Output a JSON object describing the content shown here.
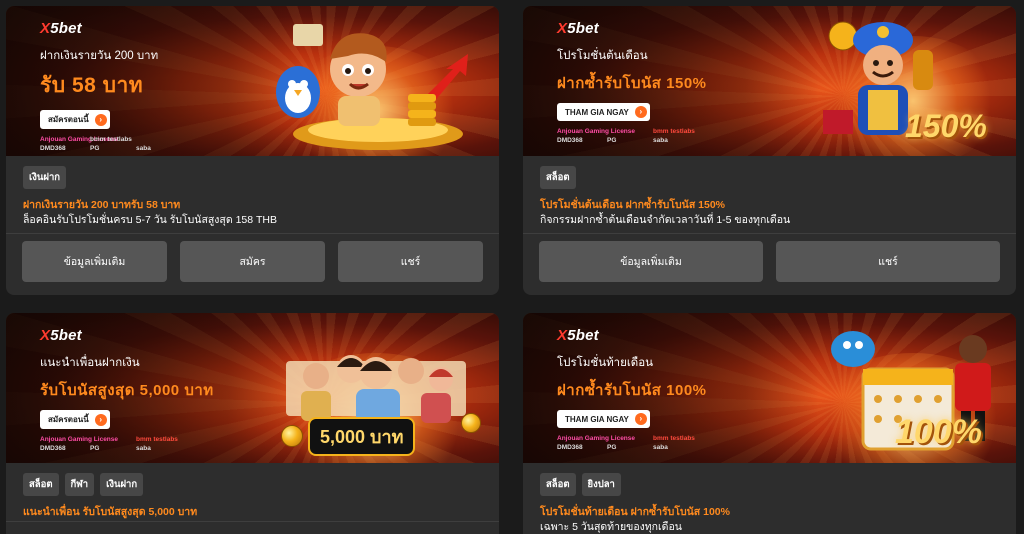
{
  "cards": [
    {
      "logo_x": "X",
      "logo_rest": "5bet",
      "banner_sub": "ฝากเงินรายวัน 200 บาท",
      "banner_head": "รับ 58 บาท",
      "banner_btn": "สมัครตอนนี้",
      "partners": [
        "Anjouan Gaming License",
        "bmm testlabs",
        "DMD368",
        "PG",
        "saba",
        "SA GAMING"
      ],
      "tags": [
        "เงินฝาก"
      ],
      "title": "ฝากเงินรายวัน 200 บาทรับ 58 บาท",
      "body": "ล็อคอินรับโปรโมชั่นครบ 5-7 วัน รับโบนัสสูงสุด 158 THB",
      "buttons": [
        "ข้อมูลเพิ่มเติม",
        "สมัคร",
        "แชร์"
      ]
    },
    {
      "logo_x": "X",
      "logo_rest": "5bet",
      "banner_sub": "โปรโมชั่นต้นเดือน",
      "banner_head": "ฝากซ้ำรับโบนัส 150%",
      "banner_btn": "THAM GIA NGAY",
      "badge": "150%",
      "partners": [
        "Anjouan Gaming License",
        "bmm testlabs",
        "DMD368",
        "PG",
        "saba",
        "SA GAMING"
      ],
      "tags": [
        "สล็อต"
      ],
      "title": "โปรโมชั่นต้นเดือน ฝากซ้ำรับโบนัส 150%",
      "body": "กิจกรรมฝากซ้ำต้นเดือนจำกัดเวลาวันที่ 1-5 ของทุกเดือน",
      "buttons": [
        "ข้อมูลเพิ่มเติม",
        "แชร์"
      ]
    },
    {
      "logo_x": "X",
      "logo_rest": "5bet",
      "banner_sub": "แนะนำเพื่อนฝากเงิน",
      "banner_head": "รับโบนัสสูงสุด 5,000 บาท",
      "banner_btn": "สมัครตอนนี้",
      "badge": "5,000 บาท",
      "partners": [
        "Anjouan Gaming License",
        "bmm testlabs",
        "DMD368",
        "PG",
        "saba",
        "SA GAMING"
      ],
      "tags": [
        "สล็อต",
        "กีฬา",
        "เงินฝาก"
      ],
      "title": "แนะนำเพื่อน รับโบนัสสูงสุด 5,000 บาท",
      "body": ""
    },
    {
      "logo_x": "X",
      "logo_rest": "5bet",
      "banner_sub": "โปรโมชั่นท้ายเดือน",
      "banner_head": "ฝากซ้ำรับโบนัส 100%",
      "banner_btn": "THAM GIA NGAY",
      "badge": "100%",
      "partners": [
        "Anjouan Gaming License",
        "bmm testlabs",
        "DMD368",
        "PG",
        "saba",
        "SA GAMING"
      ],
      "tags": [
        "สล็อต",
        "ยิงปลา"
      ],
      "title": "โปรโมชั่นท้ายเดือน ฝากซ้ำรับโบนัส 100%",
      "body": "เฉพาะ 5 วันสุดท้ายของทุกเดือน"
    }
  ],
  "colors": {
    "accent": "#ff8a1e",
    "card_bg": "#2d2d2d",
    "button_bg": "#565656",
    "tag_bg": "#474747",
    "page_bg": "#1b1b1b"
  }
}
